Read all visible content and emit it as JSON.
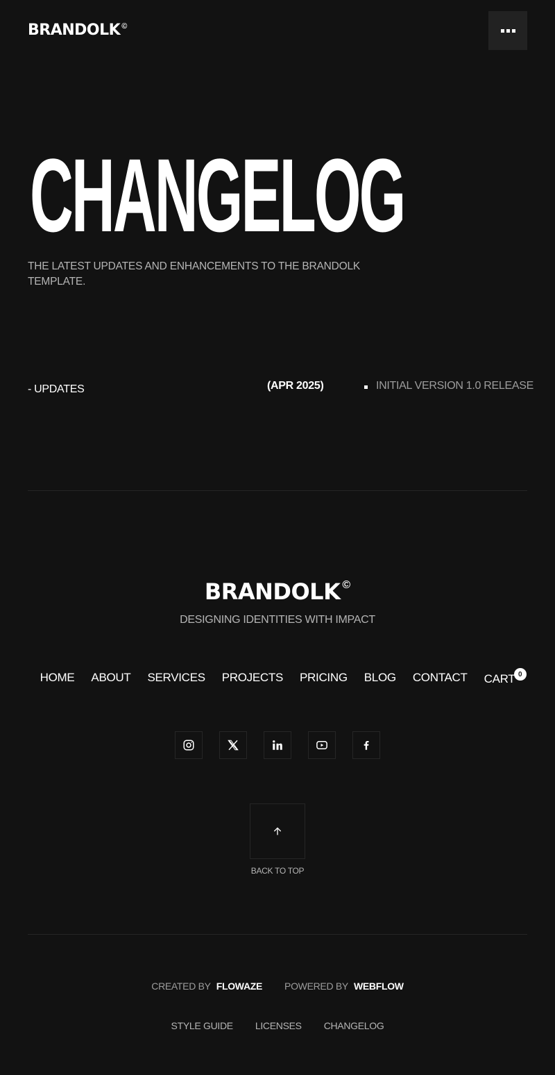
{
  "header": {
    "logo_text": "BRANDOLK",
    "logo_mark": "©",
    "menu_icon": "more-dots-icon"
  },
  "hero": {
    "title": "CHANGELOG",
    "subtitle": "THE LATEST UPDATES AND ENHANCEMENTS TO THE BRANDOLK TEMPLATE."
  },
  "updates": {
    "label": "- UPDATES",
    "entries": [
      {
        "date": "(APR 2025)",
        "items": [
          "INITIAL VERSION 1.0 RELEASE"
        ]
      }
    ]
  },
  "footer": {
    "logo_text": "BRANDOLK",
    "logo_mark": "©",
    "tagline": "DESIGNING IDENTITIES WITH IMPACT",
    "nav": [
      "HOME",
      "ABOUT",
      "SERVICES",
      "PROJECTS",
      "PRICING",
      "BLOG",
      "CONTACT"
    ],
    "cart_label": "CART",
    "cart_count": "0",
    "socials": [
      "instagram-icon",
      "x-icon",
      "linkedin-icon",
      "youtube-icon",
      "facebook-icon"
    ],
    "back_to_top": "BACK TO TOP",
    "credits": {
      "created_label": "CREATED BY",
      "created_value": "FLOWAZE",
      "powered_label": "POWERED BY",
      "powered_value": "WEBFLOW"
    },
    "bottom_links": [
      "STYLE GUIDE",
      "LICENSES",
      "CHANGELOG"
    ]
  },
  "colors": {
    "background": "#121212",
    "text": "#ffffff",
    "muted": "#b5b5b5",
    "divider": "#262626"
  }
}
